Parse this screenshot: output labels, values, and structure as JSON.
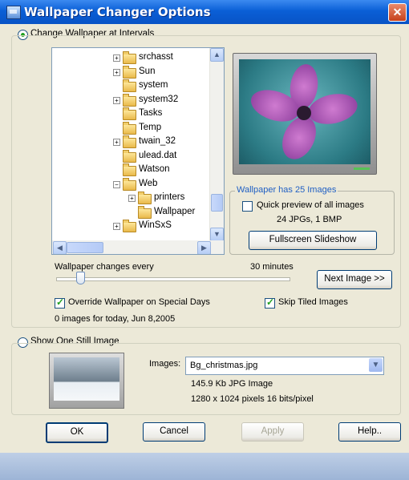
{
  "window": {
    "title": "Wallpaper Changer Options",
    "close_glyph": "✕"
  },
  "intervals": {
    "radio_label": "Change Wallpaper at Intervals",
    "selected": true,
    "tree_items": [
      {
        "label": "srchasst",
        "expander": "+"
      },
      {
        "label": "Sun",
        "expander": "+"
      },
      {
        "label": "system",
        "expander": ""
      },
      {
        "label": "system32",
        "expander": "+"
      },
      {
        "label": "Tasks",
        "expander": ""
      },
      {
        "label": "Temp",
        "expander": ""
      },
      {
        "label": "twain_32",
        "expander": "+"
      },
      {
        "label": "ulead.dat",
        "expander": ""
      },
      {
        "label": "Watson",
        "expander": ""
      },
      {
        "label": "Web",
        "expander": "−"
      },
      {
        "label": "printers",
        "expander": "+"
      },
      {
        "label": "Wallpaper",
        "expander": ""
      },
      {
        "label": "WinSxS",
        "expander": "+"
      }
    ],
    "info": {
      "group_label": "Wallpaper has 25 Images",
      "quick_preview_label": "Quick preview of all images",
      "quick_preview_checked": false,
      "counts": "24 JPGs, 1 BMP",
      "slideshow_button": "Fullscreen Slideshow"
    },
    "changes_label": "Wallpaper changes every",
    "interval_value": "30 minutes",
    "slider_fraction": 0.1,
    "next_button": "Next Image >>",
    "override_label": "Override Wallpaper on Special Days",
    "override_checked": true,
    "skip_tiled_label": "Skip Tiled Images",
    "skip_tiled_checked": true,
    "today_text": "0 images for today, Jun 8,2005"
  },
  "still": {
    "radio_label": "Show One Still Image",
    "selected": false,
    "images_label": "Images:",
    "images_value": "Bg_christmas.jpg",
    "details_line1": "145.9 Kb  JPG Image",
    "details_line2": "1280 x 1024 pixels  16 bits/pixel"
  },
  "buttons": {
    "ok": "OK",
    "cancel": "Cancel",
    "apply": "Apply",
    "help": "Help.."
  },
  "colors": {
    "title_bar": "#0a5fd6",
    "dialog_bg": "#ece9d8",
    "accent_green": "#21a121"
  }
}
